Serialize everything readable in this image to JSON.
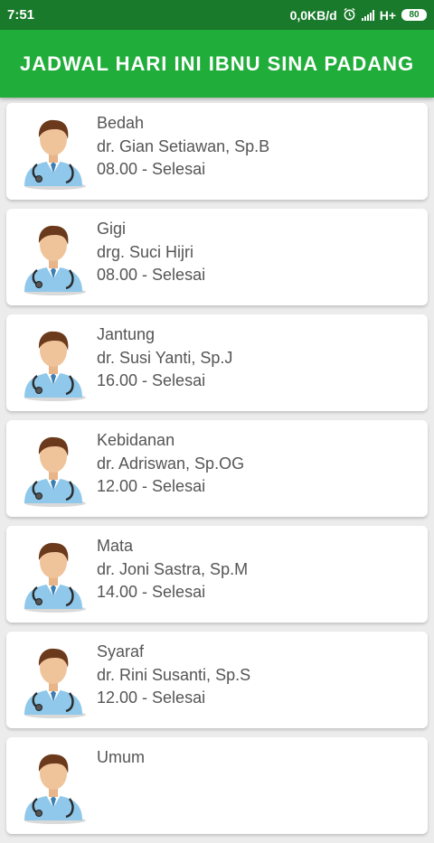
{
  "status_bar": {
    "time": "7:51",
    "data_rate": "0,0KB/d",
    "network": "H+",
    "battery": "80"
  },
  "header": {
    "title": "JADWAL HARI INI IBNU SINA PADANG"
  },
  "doctors": [
    {
      "department": "Bedah",
      "name": "dr. Gian Setiawan, Sp.B",
      "time": "08.00 - Selesai"
    },
    {
      "department": "Gigi",
      "name": "drg. Suci Hijri",
      "time": "08.00 - Selesai"
    },
    {
      "department": "Jantung",
      "name": "dr. Susi Yanti, Sp.J",
      "time": "16.00 - Selesai"
    },
    {
      "department": "Kebidanan",
      "name": "dr. Adriswan, Sp.OG",
      "time": "12.00 - Selesai"
    },
    {
      "department": "Mata",
      "name": "dr. Joni Sastra, Sp.M",
      "time": "14.00 - Selesai"
    },
    {
      "department": "Syaraf",
      "name": "dr. Rini Susanti, Sp.S",
      "time": "12.00 - Selesai"
    },
    {
      "department": "Umum",
      "name": "",
      "time": ""
    }
  ],
  "icons": {
    "avatar": "doctor-avatar-icon",
    "alarm": "alarm-icon",
    "signal": "signal-icon",
    "battery": "battery-icon"
  },
  "colors": {
    "app_bar": "#20ad3a",
    "status_bar": "#1a7a2b"
  }
}
